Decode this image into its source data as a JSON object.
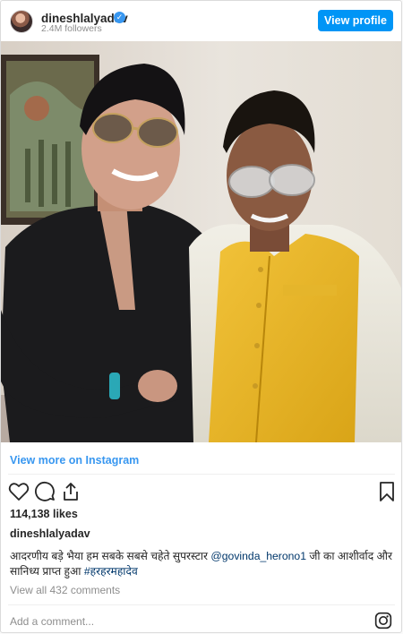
{
  "post": {
    "username": "dineshlalyadav",
    "followers": "2.4M followers",
    "view_profile": "View profile",
    "view_more": "View more on Instagram",
    "likes": "114,138 likes",
    "caption_user": "dineshlalyadav",
    "caption_text_1": "आदरणीय बड़े भैया हम सबके सबसे चहेते सुपरस्टार ",
    "caption_mention": "@govinda_herono1",
    "caption_text_2": " जी का आशीर्वाद और सानिध्य प्राप्त हुआ ",
    "caption_hashtag": "#हरहरमहादेव",
    "comments_link": "View all 432 comments",
    "comment_placeholder": "Add a comment..."
  },
  "icons": {
    "verified": "verified-badge-icon",
    "like": "heart-icon",
    "comment": "speech-bubble-icon",
    "share": "share-icon",
    "save": "bookmark-icon",
    "instagram": "instagram-logo-icon"
  },
  "colors": {
    "accent": "#0095f6",
    "link": "#3897f0",
    "mention": "#00376b",
    "muted": "#8e8e8e"
  }
}
